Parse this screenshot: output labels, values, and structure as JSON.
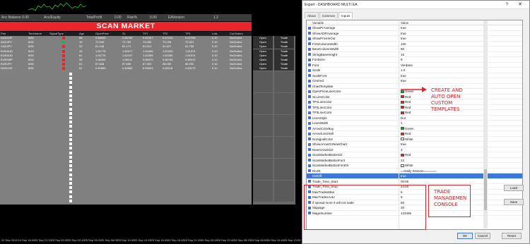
{
  "dashboard": {
    "stats": [
      "Acc Balance 0.00",
      "Acc/Equity",
      "TotalProfit",
      "0.00",
      "Risk%",
      "0.00",
      "EAVersion",
      "1.2"
    ],
    "title": "SCAN MARKET",
    "headers": [
      "Pair",
      "Timeframe",
      "SignalType",
      "Age",
      "OpenPrice",
      "SL",
      "TP1",
      "TP2",
      "TP3",
      "Lots",
      "CurOrders"
    ],
    "rows": [
      [
        "AUDCHF",
        "M30",
        "",
        "68",
        "0.66905",
        "0.66750",
        "0.67057",
        "0.67100",
        "0.67298",
        "0.10",
        "NoOrders"
      ],
      [
        "AUDJPY",
        "M30",
        "",
        "10",
        "72.945",
        "72.750",
        "73.050",
        "73.158",
        "73.301",
        "0.10",
        "NoOrders"
      ],
      [
        "CADJPY",
        "M30",
        "",
        "20",
        "81.248",
        "81.171",
        "81.513",
        "81.627",
        "81.798",
        "0.10",
        "NoOrders"
      ],
      [
        "EURAUD",
        "M15",
        "",
        "49",
        "1.61776",
        "1.62017",
        "1.61655",
        "1.61535",
        "1.61374",
        "0.10",
        "NoOrders"
      ],
      [
        "EURAUD",
        "M30",
        "",
        "61",
        "1.61776",
        "1.62197",
        "1.61565",
        "1.61355",
        "1.61074",
        "0.10",
        "NoOrders"
      ],
      [
        "EURGBP",
        "M15",
        "",
        "98",
        "1.08404",
        "1.08411",
        "0.85570",
        "0.85785",
        "0.88013",
        "0.10",
        "NoOrders"
      ],
      [
        "EURJPY",
        "M30",
        "",
        "61",
        "67.648",
        "67.696",
        "67.992",
        "68.090",
        "68.292",
        "0.10",
        "NoOrders"
      ],
      [
        "NZDUSD",
        "M30",
        "",
        "51",
        "0.62889",
        "0.62665",
        "0.63003",
        "0.63118",
        "0.63175",
        "0.10",
        "NoOrders"
      ]
    ],
    "signal_colors": [
      "red",
      "green",
      "red",
      "red",
      "red",
      "red",
      "red",
      "red"
    ],
    "buttons": {
      "open": "Open",
      "trade": "Trade"
    },
    "time_axis": [
      "24 Sep 2019",
      "24 Sep 18:40",
      "24 Sep 21:20",
      "25 Sep 00:00",
      "25 Sep 02:40",
      "25 Sep 05:20",
      "25 Sep 08:00",
      "25 Sep 10:40",
      "25 Sep 13:20",
      "25 Sep 16:00",
      "25 Sep 18:40",
      "25 Sep 21:20",
      "26 Sep 00:00",
      "26 Sep 02:40",
      "26 Sep 05:20",
      "26 Sep 08:00",
      "26 Sep 10:40",
      "26 Sep 13:20"
    ]
  },
  "dialog": {
    "title": "Expert - DASHBOARD MULTI EA",
    "help": "?",
    "close": "✕",
    "tabs": [
      "About",
      "Common",
      "Inputs"
    ],
    "col_variable": "Variable",
    "col_value": "Value",
    "params": [
      {
        "name": "ShowPrAverage",
        "value": "true"
      },
      {
        "name": "ShowADRAverage",
        "value": "true"
      },
      {
        "name": "ShowPriceInOut",
        "value": "true"
      },
      {
        "name": "FirstColumnWidth",
        "value": "100"
      },
      {
        "name": "BaseColumnWidth",
        "value": "80"
      },
      {
        "name": "StringBaseHeight",
        "value": "15"
      },
      {
        "name": "FontSize",
        "value": "8"
      },
      {
        "name": "Font",
        "value": "Verdana"
      },
      {
        "name": "Scale",
        "value": "1.0"
      },
      {
        "name": "ScaleFont",
        "value": "true"
      },
      {
        "name": "Centred",
        "value": "true"
      },
      {
        "name": "ChartTemplate",
        "value": ""
      },
      {
        "name": "OpenPriceLineColor",
        "value": "Green",
        "swatch": "#1f9d2e"
      },
      {
        "name": "SLLineColor",
        "value": "Red",
        "swatch": "#e0242a"
      },
      {
        "name": "TP1LineColor",
        "value": "Red",
        "swatch": "#e0242a"
      },
      {
        "name": "TP2LineColor",
        "value": "Red",
        "swatch": "#e0242a"
      },
      {
        "name": "TP3LineColor",
        "value": "Red",
        "swatch": "#e0242a"
      },
      {
        "name": "LinesStyle",
        "value": "Dot"
      },
      {
        "name": "LinesWidth",
        "value": "1"
      },
      {
        "name": "ArrowColorBuy",
        "value": "Green",
        "swatch": "#1f9d2e"
      },
      {
        "name": "ArrowColorSell",
        "value": "Red",
        "swatch": "#e0242a"
      },
      {
        "name": "NoSignalColor",
        "value": "White",
        "swatch": "#ffffff"
      },
      {
        "name": "ShowArrowOnNewChart",
        "value": "true"
      },
      {
        "name": "NewArrowSize",
        "value": "4"
      },
      {
        "name": "ScanMarketButtonClr",
        "value": "Red",
        "swatch": "#e0242a"
      },
      {
        "name": "ScanMarketButtonFont",
        "value": "22"
      },
      {
        "name": "ScanMarketButtonFontClr",
        "value": "White",
        "swatch": "#ffffff"
      },
      {
        "name": "Div25",
        "value": "==Daily Session======="
      },
      {
        "name": "On/Off",
        "value": "true",
        "selected": true
      },
      {
        "name": "Trade_Time_Start",
        "value": "00:00"
      },
      {
        "name": "Trade_Time_Stop",
        "value": "24:00"
      },
      {
        "name": "MaxTradesMan",
        "value": "5"
      },
      {
        "name": "MaxTradesAuto",
        "value": "5"
      },
      {
        "name": "if spread more it will not trade",
        "value": "50"
      },
      {
        "name": "Slippage",
        "value": "30"
      },
      {
        "name": "MagicNumber",
        "value": "123456"
      }
    ],
    "buttons": {
      "load": "Load",
      "save": "Save",
      "ok": "OK",
      "cancel": "Cancel",
      "reset": "Reset"
    }
  },
  "annotations": {
    "templates": "CREATE AND\nAUTO OPEN\nCUSTOM\nTEMPLATES",
    "console": "TRADE\nMANAGEMEN\nCONSOLE"
  },
  "colors": {
    "scan_red": "#e8252b",
    "grid_grey": "#808080",
    "selection_blue": "#3c78d8",
    "annotation_red": "#d7161c"
  }
}
